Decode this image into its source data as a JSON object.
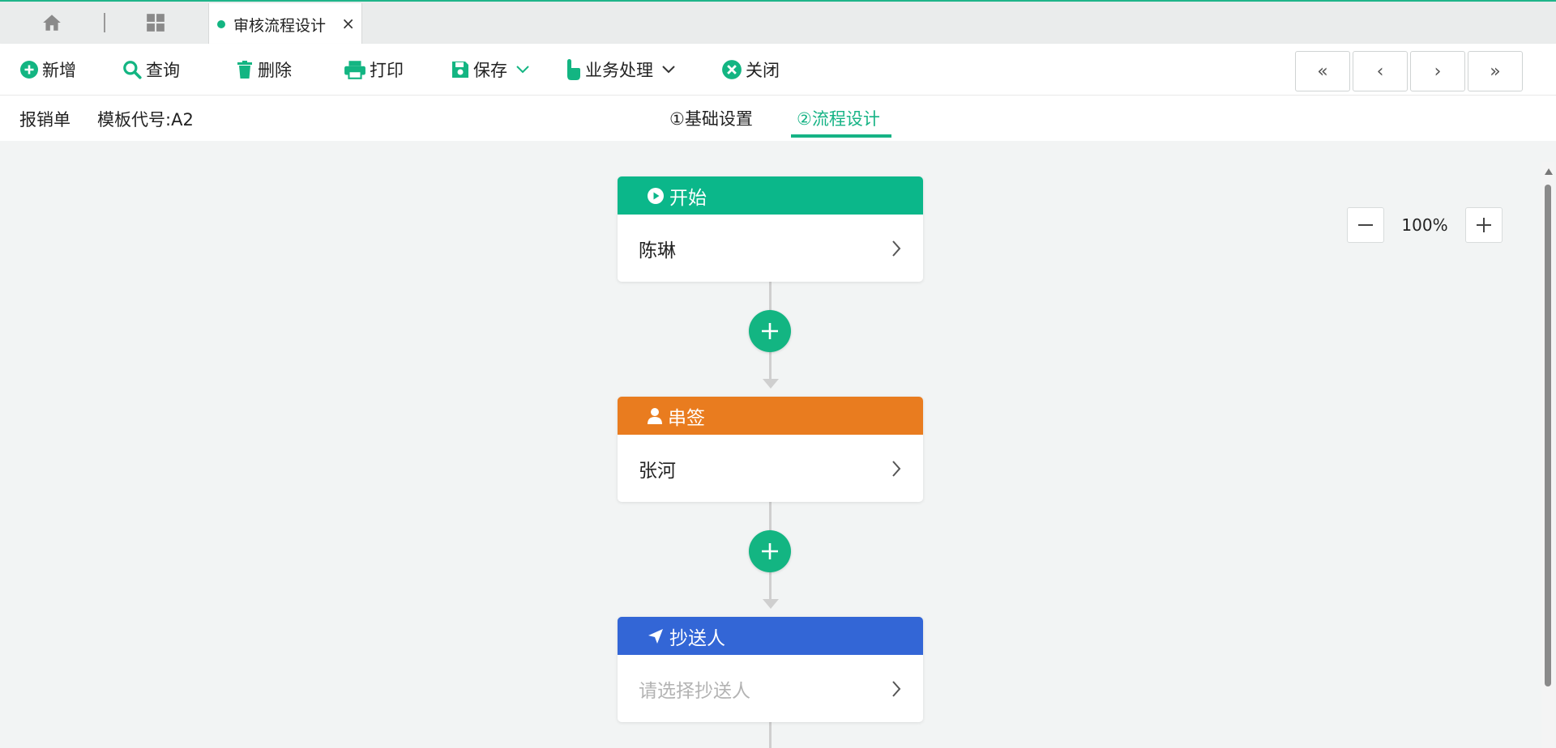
{
  "tabs": {
    "active_title": "审核流程设计",
    "close_glyph": "×",
    "accent": "#13b582"
  },
  "toolbar": {
    "add": "新增",
    "query": "查询",
    "delete": "删除",
    "print": "打印",
    "save": "保存",
    "business": "业务处理",
    "close": "关闭",
    "nav": [
      "«",
      "‹",
      "›",
      "»"
    ]
  },
  "subheader": {
    "form_name": "报销单",
    "template_code": "模板代号:A2",
    "steps": [
      "①基础设置",
      "②流程设计"
    ]
  },
  "zoom": {
    "value": "100%"
  },
  "flow": {
    "nodes": [
      {
        "type": "start",
        "title": "开始",
        "content": "陈琳",
        "color": "#0bb78a",
        "icon": "play-icon"
      },
      {
        "type": "approver",
        "title": "串签",
        "content": "张河",
        "color": "#e97c1f",
        "icon": "user-icon"
      },
      {
        "type": "cc",
        "title": "抄送人",
        "content": "请选择抄送人",
        "color": "#3366d6",
        "icon": "send-icon"
      }
    ]
  }
}
